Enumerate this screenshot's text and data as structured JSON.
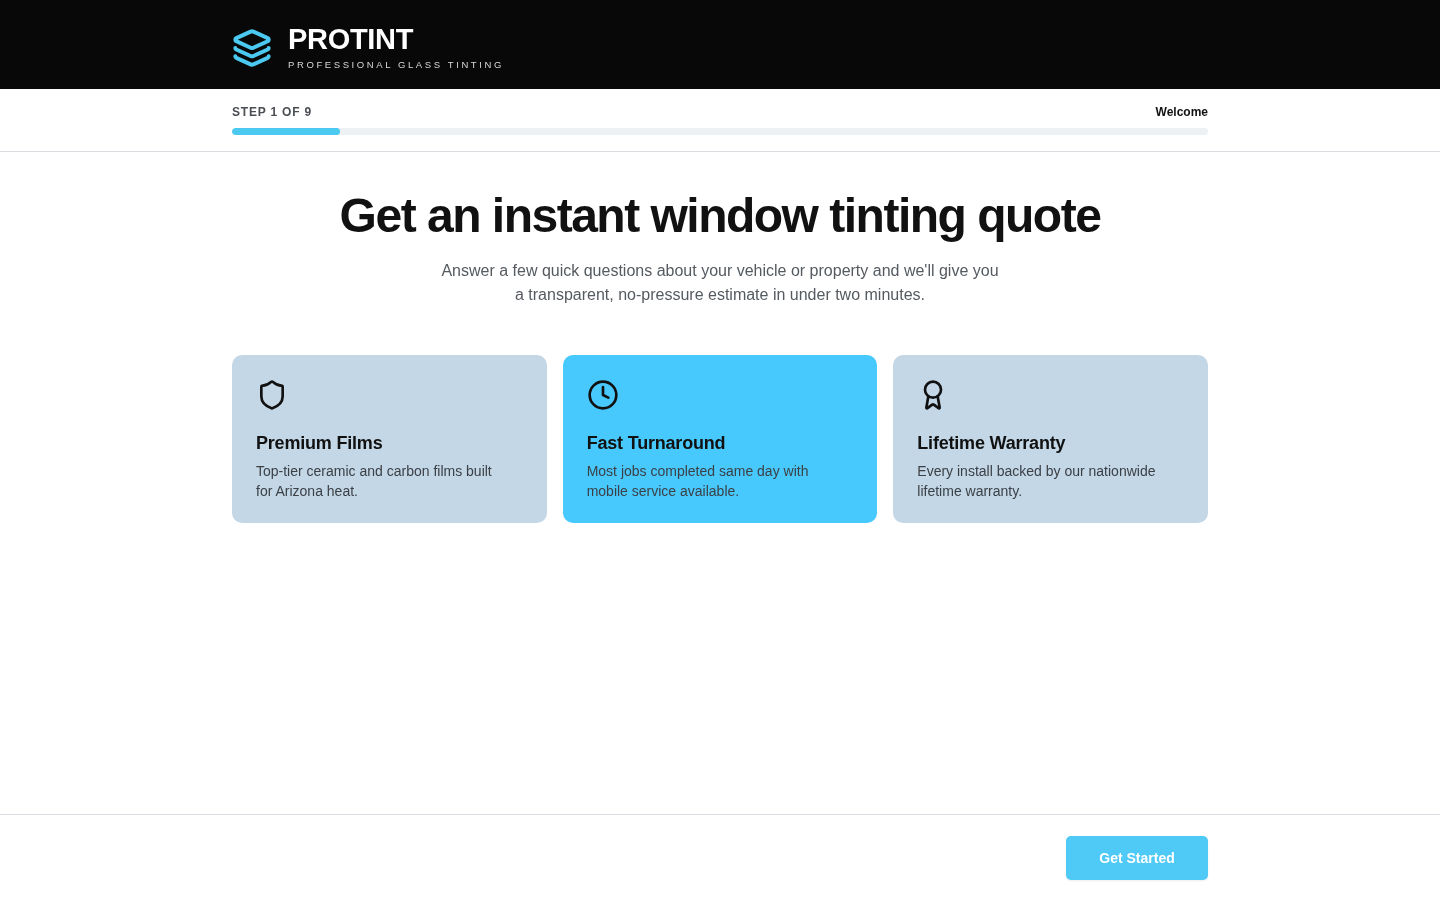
{
  "brand": {
    "name": "PROTINT",
    "tagline": "PROFESSIONAL GLASS TINTING"
  },
  "progress": {
    "step_label": "STEP 1 OF 9",
    "step_name": "Welcome",
    "level": 0.111
  },
  "hero": {
    "title": "Get an instant window tinting quote",
    "subtitle": "Answer a few quick questions about your vehicle or property and we'll give you a transparent, no-pressure estimate in under two minutes."
  },
  "features": [
    {
      "kind": "shield",
      "title": "Premium Films",
      "text": "Top-tier ceramic and carbon films built for Arizona heat.",
      "selected": false
    },
    {
      "kind": "clock",
      "title": "Fast Turnaround",
      "text": "Most jobs completed same day with mobile service available.",
      "selected": true
    },
    {
      "kind": "award",
      "title": "Lifetime Warranty",
      "text": "Every install backed by our nationwide lifetime warranty.",
      "selected": false
    }
  ],
  "footer": {
    "button": "Get Started"
  }
}
